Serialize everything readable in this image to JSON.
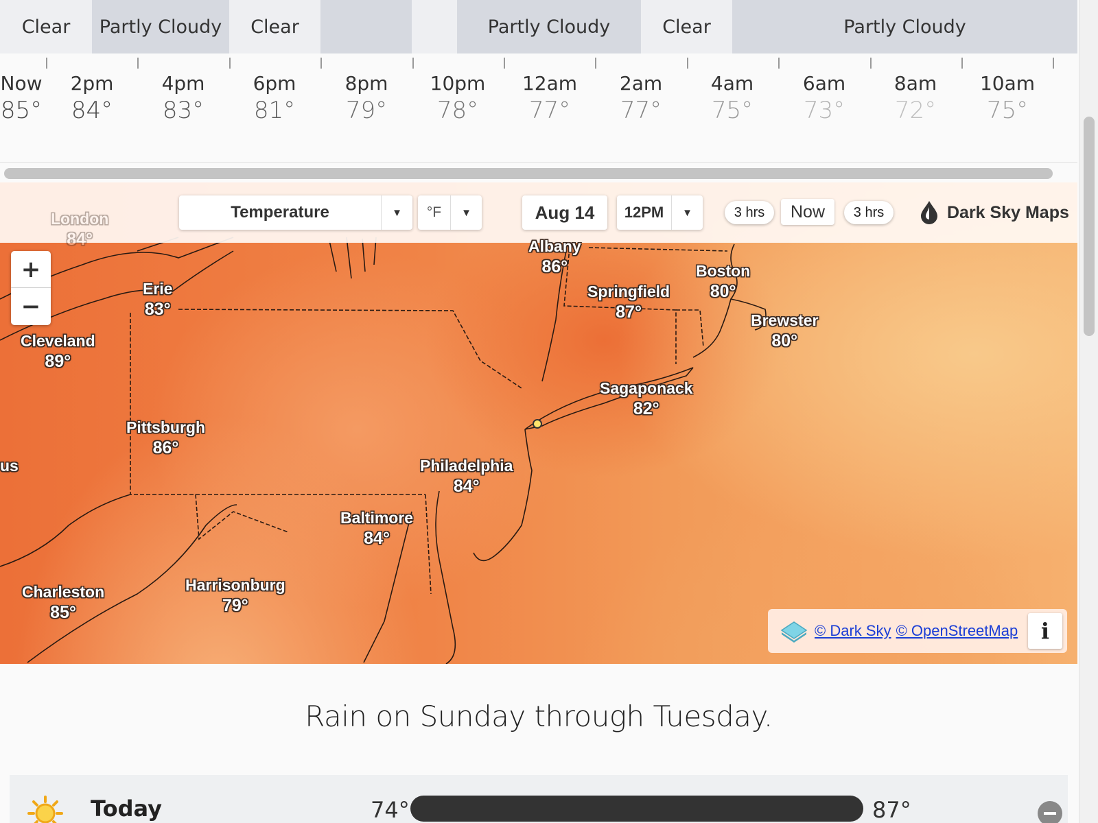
{
  "conditions": [
    {
      "label": "Clear",
      "kind": "clear"
    },
    {
      "label": "Partly Cloudy",
      "kind": "pc"
    },
    {
      "label": "Clear",
      "kind": "clear"
    },
    {
      "label": "",
      "kind": "pc"
    },
    {
      "label": "",
      "kind": "blank"
    },
    {
      "label": "Partly Cloudy",
      "kind": "pc"
    },
    {
      "label": "Clear",
      "kind": "clear"
    },
    {
      "label": "Partly Cloudy",
      "kind": "pc"
    }
  ],
  "hourly": [
    {
      "hour": "Now",
      "temp": "85°",
      "color": "#444444"
    },
    {
      "hour": "2pm",
      "temp": "84°",
      "color": "#4a4a4a"
    },
    {
      "hour": "4pm",
      "temp": "83°",
      "color": "#555555"
    },
    {
      "hour": "6pm",
      "temp": "81°",
      "color": "#5e5e5e"
    },
    {
      "hour": "8pm",
      "temp": "79°",
      "color": "#6c6c6c"
    },
    {
      "hour": "10pm",
      "temp": "78°",
      "color": "#767676"
    },
    {
      "hour": "12am",
      "temp": "77°",
      "color": "#828282"
    },
    {
      "hour": "2am",
      "temp": "77°",
      "color": "#828282"
    },
    {
      "hour": "4am",
      "temp": "75°",
      "color": "#9a9a9a"
    },
    {
      "hour": "6am",
      "temp": "73°",
      "color": "#b3b3b3"
    },
    {
      "hour": "8am",
      "temp": "72°",
      "color": "#c0c0c0"
    },
    {
      "hour": "10am",
      "temp": "75°",
      "color": "#9a9a9a"
    }
  ],
  "map": {
    "layer": "Temperature",
    "unit": "°F",
    "date": "Aug 14",
    "time": "12PM",
    "step_back": "3 hrs",
    "now": "Now",
    "step_forward": "3 hrs",
    "brand": "Dark Sky Maps",
    "zoom_in": "+",
    "zoom_out": "−",
    "attribution_darksky": "© Dark Sky",
    "attribution_osm": "© OpenStreetMap",
    "info": "i",
    "cities": [
      {
        "name": "London",
        "temp": "84°",
        "faint": true
      },
      {
        "name": "Erie",
        "temp": "83°"
      },
      {
        "name": "Cleveland",
        "temp": "89°"
      },
      {
        "name": "Albany",
        "temp": "86°"
      },
      {
        "name": "Springfield",
        "temp": "87°"
      },
      {
        "name": "Boston",
        "temp": "80°"
      },
      {
        "name": "Brewster",
        "temp": "80°"
      },
      {
        "name": "Sagaponack",
        "temp": "82°"
      },
      {
        "name": "Pittsburgh",
        "temp": "86°"
      },
      {
        "name": "Philadelphia",
        "temp": "84°"
      },
      {
        "name": "Baltimore",
        "temp": "84°"
      },
      {
        "name": "Charleston",
        "temp": "85°"
      },
      {
        "name": "Harrisonburg",
        "temp": "79°"
      },
      {
        "name": "us",
        "temp": ""
      }
    ]
  },
  "summary": "Rain on Sunday through Tuesday.",
  "daily": {
    "label": "Today",
    "low": "74°",
    "high": "87°",
    "icon": "sun-icon"
  }
}
